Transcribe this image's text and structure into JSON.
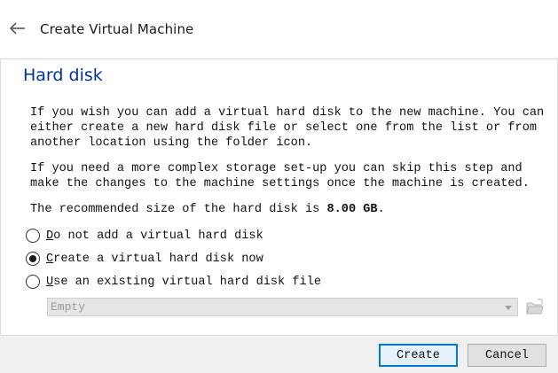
{
  "window": {
    "title": "Create Virtual Machine",
    "back_icon": "back-arrow-icon"
  },
  "page": {
    "heading": "Hard disk",
    "paragraph1": "If you wish you can add a virtual hard disk to the new machine. You can\neither create a new hard disk file or select one from the list or from\nanother location using the folder icon.",
    "paragraph2": "If you need a more complex storage set-up you can skip this step and\nmake the changes to the machine settings once the machine is created.",
    "recommended_prefix": "The recommended size of the hard disk is ",
    "recommended_size": "8.00 GB",
    "recommended_suffix": "."
  },
  "options": [
    {
      "mnemonic": "D",
      "rest": "o not add a virtual hard disk",
      "selected": false
    },
    {
      "mnemonic": "C",
      "rest": "reate a virtual hard disk now",
      "selected": true
    },
    {
      "mnemonic": "U",
      "rest": "se an existing virtual hard disk file",
      "selected": false
    }
  ],
  "disk_select": {
    "value": "Empty",
    "enabled": false,
    "folder_icon": "folder-open-icon"
  },
  "buttons": {
    "create": "Create",
    "cancel": "Cancel"
  },
  "colors": {
    "heading": "#003399",
    "default_button_border": "#0078d7"
  }
}
